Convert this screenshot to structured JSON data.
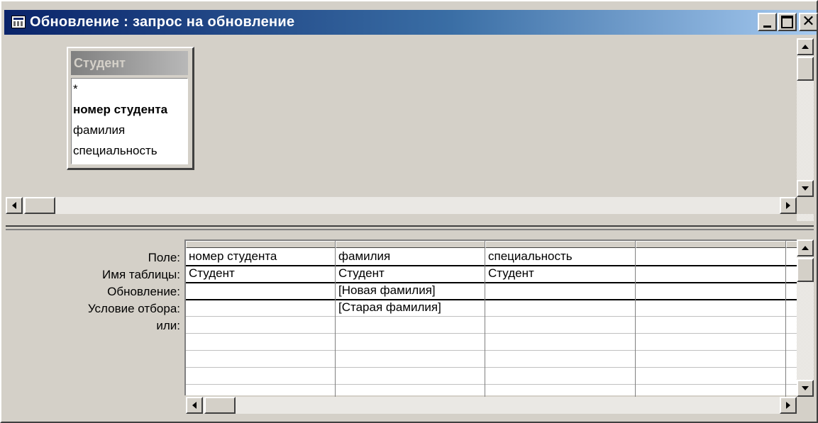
{
  "window": {
    "title": "Обновление : запрос на обновление",
    "controls": {
      "minimize": "minimize-icon",
      "maximize": "maximize-icon",
      "close": "✕"
    }
  },
  "table_box": {
    "title": "Студент",
    "fields": [
      "*",
      "номер студента",
      "фамилия",
      "специальность"
    ],
    "key_field_index": 1
  },
  "grid": {
    "row_labels": [
      "Поле:",
      "Имя таблицы:",
      "Обновление:",
      "Условие отбора:",
      "или:"
    ],
    "columns": [
      {
        "field": "номер студента",
        "table": "Студент",
        "update": "",
        "criteria": "",
        "or": ""
      },
      {
        "field": "фамилия",
        "table": "Студент",
        "update": "[Новая фамилия]",
        "criteria": "[Старая фамилия]",
        "or": ""
      },
      {
        "field": "специальность",
        "table": "Студент",
        "update": "",
        "criteria": "",
        "or": ""
      },
      {
        "field": "",
        "table": "",
        "update": "",
        "criteria": "",
        "or": ""
      }
    ]
  },
  "icons": {
    "app": "query-window-icon",
    "scroll_up": "scroll-up-arrow-icon",
    "scroll_down": "scroll-down-arrow-icon",
    "scroll_left": "scroll-left-arrow-icon",
    "scroll_right": "scroll-right-arrow-icon"
  },
  "colors": {
    "titlebar_start": "#0a246a",
    "titlebar_end": "#a6caf0",
    "face": "#d4d0c8"
  }
}
